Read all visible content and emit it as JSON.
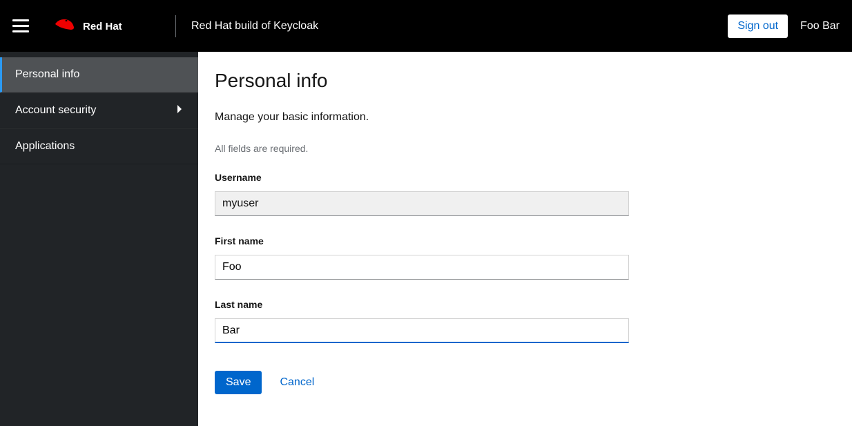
{
  "header": {
    "brand": "Red Hat",
    "app_title": "Red Hat build of Keycloak",
    "signout_label": "Sign out",
    "user_display_name": "Foo Bar"
  },
  "sidebar": {
    "items": [
      {
        "label": "Personal info",
        "active": true,
        "expandable": false
      },
      {
        "label": "Account security",
        "active": false,
        "expandable": true
      },
      {
        "label": "Applications",
        "active": false,
        "expandable": false
      }
    ]
  },
  "main": {
    "title": "Personal info",
    "subtitle": "Manage your basic information.",
    "required_note": "All fields are required.",
    "fields": {
      "username": {
        "label": "Username",
        "value": "myuser",
        "readonly": true
      },
      "first_name": {
        "label": "First name",
        "value": "Foo",
        "readonly": false
      },
      "last_name": {
        "label": "Last name",
        "value": "Bar",
        "readonly": false,
        "focused": true
      }
    },
    "buttons": {
      "save": "Save",
      "cancel": "Cancel"
    }
  }
}
